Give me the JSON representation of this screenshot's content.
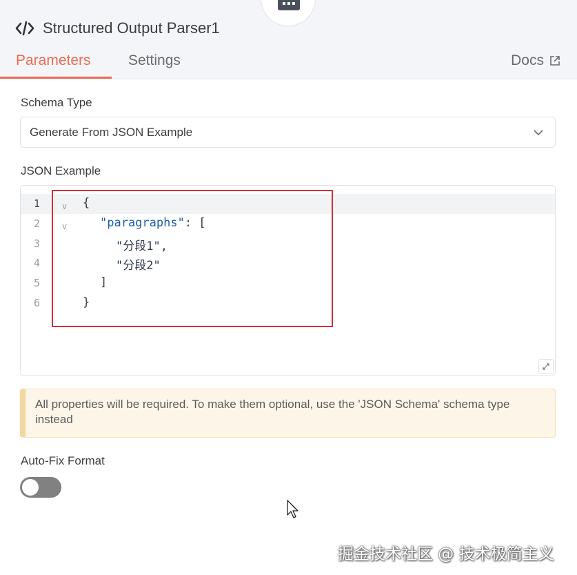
{
  "header": {
    "title": "Structured Output Parser1",
    "tabs": [
      {
        "label": "Parameters",
        "active": true
      },
      {
        "label": "Settings",
        "active": false
      }
    ],
    "docs_label": "Docs"
  },
  "schema_type": {
    "label": "Schema Type",
    "selected": "Generate From JSON Example"
  },
  "json_example": {
    "label": "JSON Example",
    "line_numbers": [
      "1",
      "2",
      "3",
      "4",
      "5",
      "6"
    ],
    "lines": [
      {
        "text": "{"
      },
      {
        "key": "\"paragraphs\"",
        "rest": ": ["
      },
      {
        "value": "\"分段1\"",
        "rest": ","
      },
      {
        "value": "\"分段2\"",
        "rest": ""
      },
      {
        "text": "]"
      },
      {
        "text": "}"
      }
    ]
  },
  "notice": {
    "text": "All properties will be required. To make them optional, use the 'JSON Schema' schema type instead"
  },
  "auto_fix": {
    "label": "Auto-Fix Format",
    "enabled": false
  },
  "watermark": "掘金技术社区 @ 技术极简主义",
  "colors": {
    "accent": "#ea6b54",
    "highlight_box": "#cf2f37",
    "notice_bg": "#fdf6e8",
    "toggle_off": "#818181"
  },
  "icons": [
    "robot-icon",
    "code-icon",
    "external-link-icon",
    "chevron-down-icon",
    "resize-icon",
    "mouse-cursor-icon"
  ]
}
